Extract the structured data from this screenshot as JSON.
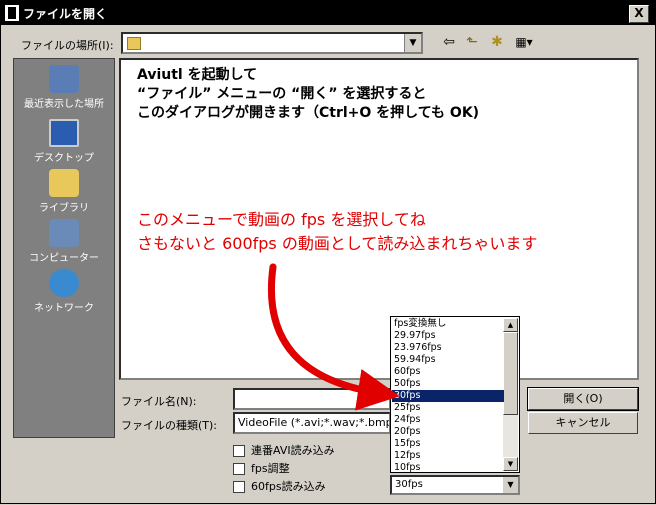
{
  "window": {
    "title": "ファイルを開く",
    "close_glyph": "X"
  },
  "lookin": {
    "label": "ファイルの場所(I):",
    "value": ""
  },
  "toolbar": {
    "back": "⇦",
    "up": "⬑",
    "newfolder": "✱",
    "view": "▦▾"
  },
  "places": [
    {
      "label": "最近表示した場所",
      "icon": "recent-places-icon",
      "color": "#5a7db5"
    },
    {
      "label": "デスクトップ",
      "icon": "desktop-icon",
      "color": "#2a5db0"
    },
    {
      "label": "ライブラリ",
      "icon": "libraries-icon",
      "color": "#e8c85a"
    },
    {
      "label": "コンピューター",
      "icon": "computer-icon",
      "color": "#6a8ab8"
    },
    {
      "label": "ネットワーク",
      "icon": "network-icon",
      "color": "#3a8ad0"
    }
  ],
  "annotation": {
    "top": "Aviutl を起動して\n“ファイル” メニューの “開く” を選択すると\nこのダイアログが開きます（Ctrl+O を押しても OK)",
    "red": "このメニューで動画の fps を選択してね\nさもないと 600fps の動画として読み込まれちゃいます",
    "red_color": "#e00000"
  },
  "filename": {
    "label": "ファイル名(N):",
    "value": ""
  },
  "filetype": {
    "label": "ファイルの種類(T):",
    "value": "VideoFile (*.avi;*.wav;*.bmp;*.j"
  },
  "buttons": {
    "open": "開く(O)",
    "cancel": "キャンセル"
  },
  "checkboxes": [
    {
      "label": "連番AVI読み込み",
      "checked": false
    },
    {
      "label": "fps調整",
      "checked": false
    },
    {
      "label": "60fps読み込み",
      "checked": false
    }
  ],
  "fps_dropdown": {
    "options": [
      "fps変換無し",
      "29.97fps",
      "23.976fps",
      "59.94fps",
      "60fps",
      "50fps",
      "30fps",
      "25fps",
      "24fps",
      "20fps",
      "15fps",
      "12fps",
      "10fps"
    ],
    "selected_index": 6,
    "selected_value": "30fps"
  }
}
